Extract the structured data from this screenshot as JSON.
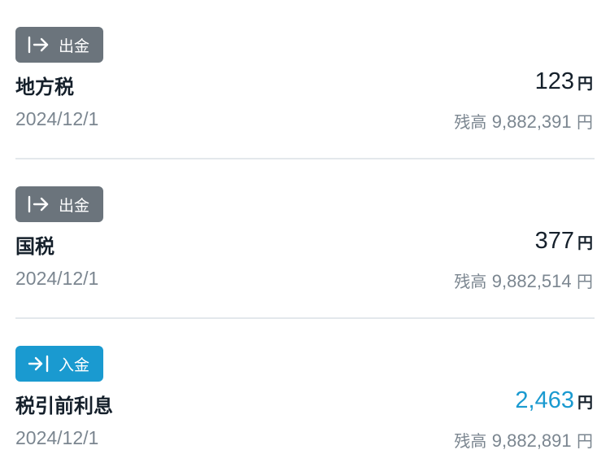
{
  "transactions": [
    {
      "type_label": "出金",
      "type_icon": "arrow-bar-right-icon",
      "type_color": "#6b747c",
      "title": "地方税",
      "amount": "123",
      "currency": "円",
      "date": "2024/12/1",
      "balance_label": "残高",
      "balance_value": "9,882,391",
      "balance_currency": "円"
    },
    {
      "type_label": "出金",
      "type_icon": "arrow-bar-right-icon",
      "type_color": "#6b747c",
      "title": "国税",
      "amount": "377",
      "currency": "円",
      "date": "2024/12/1",
      "balance_label": "残高",
      "balance_value": "9,882,514",
      "balance_currency": "円"
    },
    {
      "type_label": "入金",
      "type_icon": "arrow-into-bar-icon",
      "type_color": "#1a9ad0",
      "title": "税引前利息",
      "amount": "2,463",
      "amount_color": "#1a9ad0",
      "currency": "円",
      "date": "2024/12/1",
      "balance_label": "残高",
      "balance_value": "9,882,891",
      "balance_currency": "円"
    }
  ]
}
